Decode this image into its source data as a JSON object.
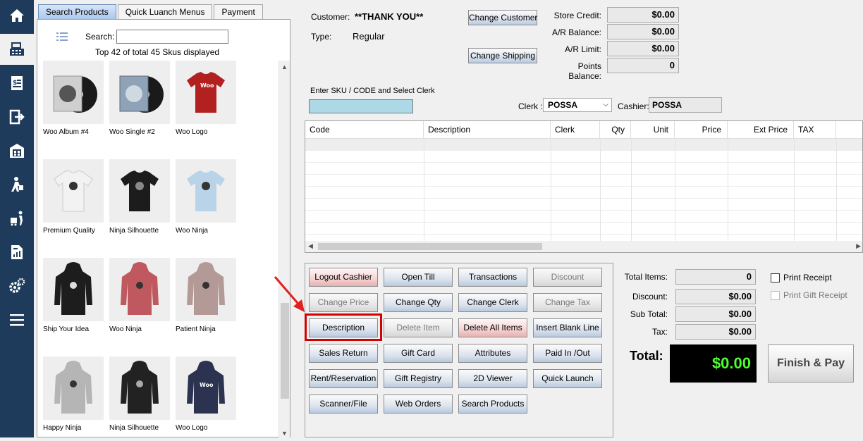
{
  "tabs": [
    "Search Products",
    "Quick Luanch Menus",
    "Payment"
  ],
  "search": {
    "label": "Search:",
    "value": "",
    "summary": "Top 42 of total 45 Skus displayed"
  },
  "products": [
    {
      "name": "Woo Album #4",
      "kind": "vinyl"
    },
    {
      "name": "Woo Single #2",
      "kind": "vinyl"
    },
    {
      "name": "Woo Logo",
      "kind": "tshirt-red"
    },
    {
      "name": "Premium Quality",
      "kind": "tshirt-white"
    },
    {
      "name": "Ninja Silhouette",
      "kind": "tshirt-black"
    },
    {
      "name": "Woo Ninja",
      "kind": "tshirt-blue"
    },
    {
      "name": "Ship Your Idea",
      "kind": "hoodie-black"
    },
    {
      "name": "Woo Ninja",
      "kind": "hoodie-pink"
    },
    {
      "name": "Patient Ninja",
      "kind": "hoodie-tan"
    },
    {
      "name": "Happy Ninja",
      "kind": "hoodie-gray"
    },
    {
      "name": "Ninja Silhouette",
      "kind": "hoodie-black"
    },
    {
      "name": "Woo Logo",
      "kind": "hoodie-navy"
    }
  ],
  "customer": {
    "label": "Customer:",
    "value": "**THANK YOU**",
    "type_label": "Type:",
    "type_value": "Regular",
    "change_customer": "Change Customer",
    "change_shipping": "Change Shipping"
  },
  "balances": [
    {
      "label": "Store Credit:",
      "value": "$0.00"
    },
    {
      "label": "A/R Balance:",
      "value": "$0.00"
    },
    {
      "label": "A/R Limit:",
      "value": "$0.00"
    },
    {
      "label": "Points Balance:",
      "value": "0"
    }
  ],
  "sku": {
    "label": "Enter SKU / CODE and Select Clerk",
    "value": "",
    "clerk_label": "Clerk :",
    "clerk_value": "POSSA",
    "cashier_label": "Cashier:",
    "cashier_value": "POSSA"
  },
  "table_columns": [
    "Code",
    "Description",
    "Clerk",
    "Qty",
    "Unit",
    "Price",
    "Ext Price",
    "TAX"
  ],
  "buttons": [
    {
      "label": "Logout Cashier",
      "style": "red"
    },
    {
      "label": "Open Till",
      "style": "normal"
    },
    {
      "label": "Transactions",
      "style": "normal"
    },
    {
      "label": "Discount",
      "style": "disabled"
    },
    {
      "label": "Change Price",
      "style": "disabled"
    },
    {
      "label": "Change Qty",
      "style": "normal"
    },
    {
      "label": "Change Clerk",
      "style": "normal"
    },
    {
      "label": "Change Tax",
      "style": "disabled"
    },
    {
      "label": "Description",
      "style": "normal"
    },
    {
      "label": "Delete Item",
      "style": "disabled"
    },
    {
      "label": "Delete All Items",
      "style": "red"
    },
    {
      "label": "Insert Blank Line",
      "style": "normal"
    },
    {
      "label": "Sales Return",
      "style": "normal"
    },
    {
      "label": "Gift Card",
      "style": "normal"
    },
    {
      "label": "Attributes",
      "style": "normal"
    },
    {
      "label": "Paid In /Out",
      "style": "normal"
    },
    {
      "label": "Rent/Reservation",
      "style": "normal"
    },
    {
      "label": "Gift Registry",
      "style": "normal"
    },
    {
      "label": "2D Viewer",
      "style": "normal"
    },
    {
      "label": "Quick Launch",
      "style": "normal"
    },
    {
      "label": "Scanner/File",
      "style": "normal"
    },
    {
      "label": "Web Orders",
      "style": "normal"
    },
    {
      "label": "Search Products",
      "style": "normal"
    }
  ],
  "totals": [
    {
      "label": "Total Items:",
      "value": "0"
    },
    {
      "label": "Discount:",
      "value": "$0.00"
    },
    {
      "label": "Sub Total:",
      "value": "$0.00"
    },
    {
      "label": "Tax:",
      "value": "$0.00"
    }
  ],
  "print_receipt": "Print Receipt",
  "print_gift_receipt": "Print Gift Receipt",
  "total_label": "Total:",
  "total_value": "$0.00",
  "finish_pay": "Finish & Pay",
  "colors": {
    "sidebar": "#1e3b5c",
    "total_text": "#4cff2d",
    "highlight": "#d40000"
  }
}
